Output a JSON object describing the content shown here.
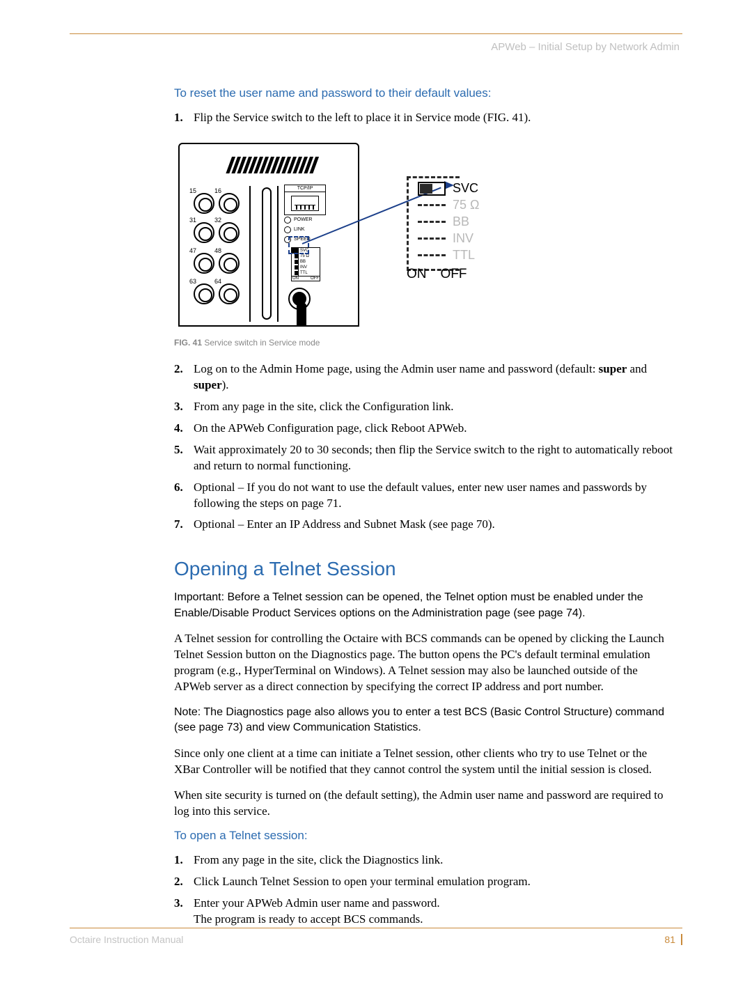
{
  "header": {
    "title": "APWeb – Initial Setup by Network Admin"
  },
  "reset": {
    "heading": "To reset the user name and password to their default values:",
    "step1": "Flip the Service switch to the left to place it in Service mode (FIG. 41).",
    "step2a": "Log on to the Admin Home page, using the Admin user name and password (default: ",
    "step2b": "super",
    "step2c": " and ",
    "step2d": "super",
    "step2e": ").",
    "step3": "From any page in the site, click the Configuration link.",
    "step4": "On the APWeb Configuration page, click Reboot APWeb.",
    "step5": "Wait approximately 20 to 30 seconds; then flip the Service switch to the right to automatically reboot and return to normal functioning.",
    "step6": "Optional – If you do not want to use the default values, enter new user names and passwords by following the steps on page 71.",
    "step7": "Optional – Enter an IP Address and Subnet Mask (see page 70)."
  },
  "figure": {
    "caption_label": "FIG. 41",
    "caption_text": "  Service switch in Service mode",
    "labels": {
      "p15": "15",
      "p16": "16",
      "p31": "31",
      "p32": "32",
      "p47": "47",
      "p48": "48",
      "p63": "63",
      "p64": "64",
      "tcpip": "TCP/IP",
      "power": "POWER",
      "link": "LINK",
      "speed": "SPEED",
      "svc": "SVC",
      "ohm": "75 Ω",
      "bb": "BB",
      "inv": "INV",
      "ttl": "TTL",
      "on": "ON",
      "off": "OFF"
    },
    "zoom": {
      "svc": "SVC",
      "ohm": "75 Ω",
      "bb": "BB",
      "inv": "INV",
      "ttl": "TTL",
      "on": "ON",
      "off": "OFF"
    }
  },
  "telnet": {
    "heading": "Opening a Telnet Session",
    "important": "Important:  Before a Telnet session can be opened, the Telnet option must be enabled under the Enable/Disable Product Services options on the Administration page (see page 74).",
    "p1": "A Telnet session for controlling the Octaire with BCS commands can be opened by clicking the Launch Telnet Session button on the Diagnostics page. The button opens the PC's default terminal emulation program (e.g., HyperTerminal on Windows). A Telnet session may also be launched outside of the APWeb server as a direct connection by specifying the correct IP address and port number.",
    "note": "Note: The Diagnostics page also allows you to enter a test BCS (Basic Control Structure) command (see page 73) and view Communication Statistics.",
    "p2": "Since only one client at a time can initiate a Telnet session, other clients who try to use Telnet or the XBar Controller will be notified that they cannot control the system until the initial session is closed.",
    "p3": "When site security is turned on (the default setting), the Admin user name and password are required to log into this service.",
    "sub": "To open a Telnet session:",
    "s1": "From any page in the site, click the Diagnostics link.",
    "s2": "Click Launch Telnet Session to open your terminal emulation program.",
    "s3a": "Enter your APWeb Admin user name and password.",
    "s3b": "The program is ready to accept BCS commands."
  },
  "footer": {
    "manual": "Octaire Instruction Manual",
    "page": "81"
  }
}
